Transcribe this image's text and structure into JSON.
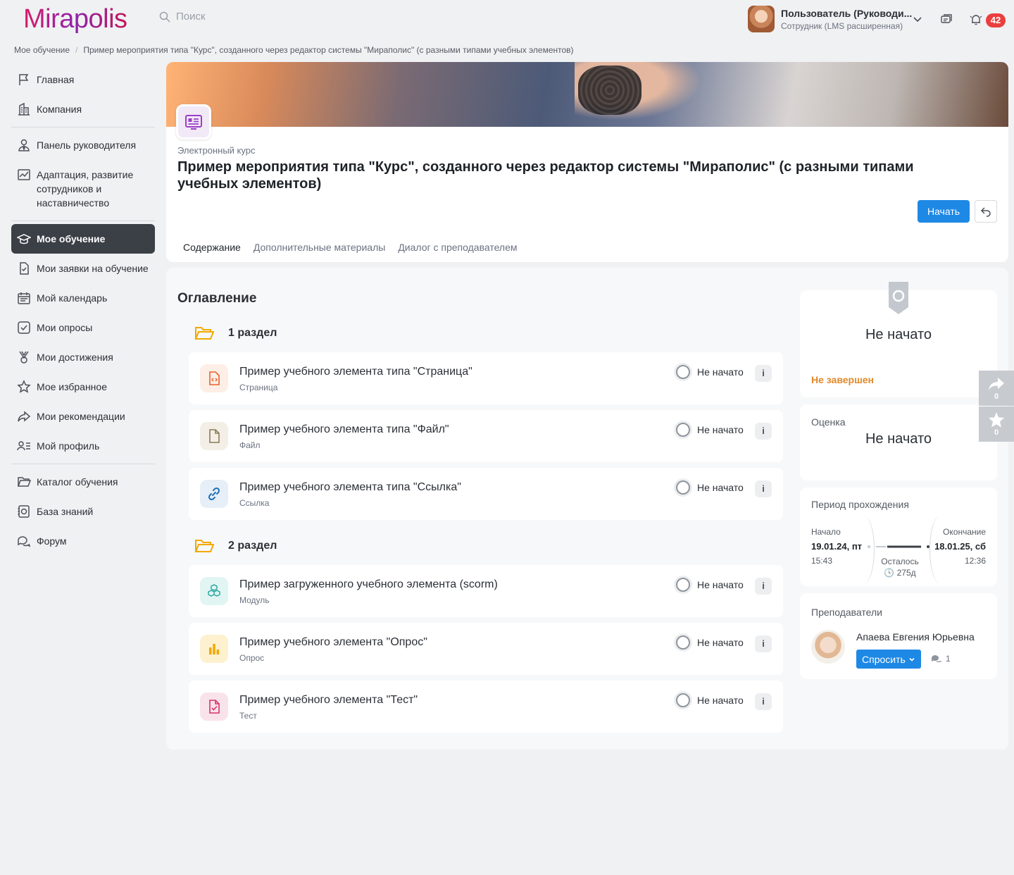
{
  "app": {
    "logo": "Mirapolis",
    "search_placeholder": "Поиск"
  },
  "user": {
    "name": "Пользователь (Руководи...",
    "role": "Сотрудник (LMS расширенная)",
    "notifications": "42"
  },
  "breadcrumb": [
    "Мое обучение",
    "Пример мероприятия типа \"Курс\", созданного через редактор системы \"Мираполис\" (с разными типами учебных элементов)"
  ],
  "sidebar": {
    "items": [
      {
        "label": "Главная",
        "icon": "flag-icon"
      },
      {
        "label": "Компания",
        "icon": "building-icon"
      },
      {
        "label": "Панель руководителя",
        "icon": "manager-icon"
      },
      {
        "label": "Адаптация, развитие сотрудников и наставничество",
        "icon": "chart-icon"
      },
      {
        "label": "Мое обучение",
        "icon": "graduation-cap-icon",
        "active": true
      },
      {
        "label": "Мои заявки на обучение",
        "icon": "request-icon"
      },
      {
        "label": "Мой календарь",
        "icon": "calendar-icon"
      },
      {
        "label": "Мои опросы",
        "icon": "survey-icon"
      },
      {
        "label": "Мои достижения",
        "icon": "medal-icon"
      },
      {
        "label": "Мое избранное",
        "icon": "star-icon"
      },
      {
        "label": "Мои рекомендации",
        "icon": "share-icon"
      },
      {
        "label": "Мой профиль",
        "icon": "profile-icon"
      },
      {
        "label": "Каталог обучения",
        "icon": "folder-icon"
      },
      {
        "label": "База знаний",
        "icon": "knowledge-icon"
      },
      {
        "label": "Форум",
        "icon": "forum-icon"
      }
    ]
  },
  "course": {
    "type": "Электронный курс",
    "title": "Пример мероприятия типа \"Курс\", созданного через редактор системы \"Мираполис\" (с разными типами учебных элементов)",
    "start_label": "Начать",
    "tabs": [
      "Содержание",
      "Дополнительные материалы",
      "Диалог с преподавателем"
    ]
  },
  "toc": {
    "title": "Оглавление",
    "sections": [
      {
        "name": "1 раздел",
        "items": [
          {
            "title": "Пример учебного элемента типа \"Страница\"",
            "sub": "Страница",
            "status": "Не начато",
            "icon": "page-icon",
            "color": "#e8622c",
            "bg": "#fdeee6"
          },
          {
            "title": "Пример учебного элемента типа \"Файл\"",
            "sub": "Файл",
            "status": "Не начато",
            "icon": "file-icon",
            "color": "#8c7a5a",
            "bg": "#f3efe6"
          },
          {
            "title": "Пример учебного элемента типа \"Ссылка\"",
            "sub": "Ссылка",
            "status": "Не начато",
            "icon": "link-icon",
            "color": "#1e6fb8",
            "bg": "#e6eef7"
          }
        ]
      },
      {
        "name": "2 раздел",
        "items": [
          {
            "title": "Пример загруженного учебного элемента (scorm)",
            "sub": "Модуль",
            "status": "Не начато",
            "icon": "cubes-icon",
            "color": "#22a39a",
            "bg": "#e1f5f3"
          },
          {
            "title": "Пример учебного элемента \"Опрос\"",
            "sub": "Опрос",
            "status": "Не начато",
            "icon": "bar-chart-icon",
            "color": "#f2a900",
            "bg": "#fdf1cf"
          },
          {
            "title": "Пример учебного элемента \"Тест\"",
            "sub": "Тест",
            "status": "Не начато",
            "icon": "test-icon",
            "color": "#d6336c",
            "bg": "#f9e3ea"
          }
        ]
      }
    ]
  },
  "panel": {
    "status": "Не начато",
    "completion": "Не завершен",
    "grade_label": "Оценка",
    "grade_value": "Не начато",
    "period": {
      "label": "Период прохождения",
      "start_label": "Начало",
      "start_date": "19.01.24, пт",
      "start_time": "15:43",
      "end_label": "Окончание",
      "end_date": "18.01.25, сб",
      "end_time": "12:36",
      "remain_label": "Осталось",
      "remain_value": "275д"
    },
    "teachers": {
      "label": "Преподаватели",
      "name": "Апаева Евгения Юрьевна",
      "ask_label": "Спросить",
      "messages": "1"
    }
  },
  "floats": {
    "share_count": "0",
    "fav_count": "0"
  },
  "colors": {
    "accent": "#1e88e5",
    "active_nav": "#3b3f46",
    "warning": "#e0892b",
    "badge": "#ea3f3f"
  }
}
